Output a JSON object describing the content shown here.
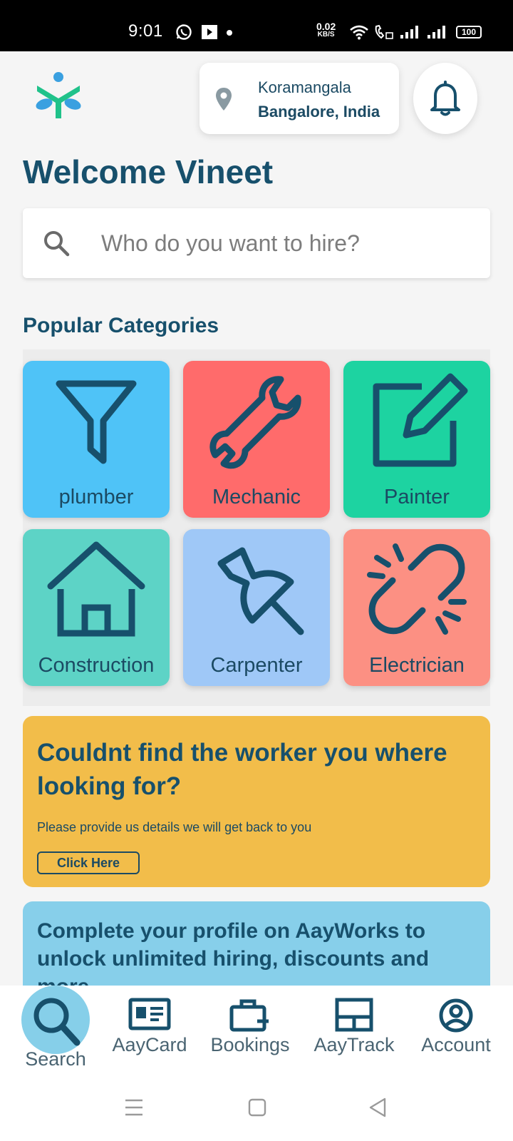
{
  "status_bar": {
    "time": "9:01",
    "net_speed": "0.02",
    "net_unit": "KB/S",
    "battery": "100"
  },
  "location": {
    "area": "Koramangala",
    "city": "Bangalore, India"
  },
  "welcome": "Welcome Vineet",
  "search": {
    "placeholder": "Who do you want to hire?"
  },
  "popular_title": "Popular Categories",
  "categories": [
    {
      "label": "plumber",
      "icon": "funnel-icon",
      "color": "#4fc3f7"
    },
    {
      "label": "Mechanic",
      "icon": "wrench-icon",
      "color": "#ff6b6b"
    },
    {
      "label": "Painter",
      "icon": "edit-icon",
      "color": "#1dd3a1"
    },
    {
      "label": "Construction",
      "icon": "house-icon",
      "color": "#5dd3c6"
    },
    {
      "label": "Carpenter",
      "icon": "pushpin-icon",
      "color": "#9fc8f7"
    },
    {
      "label": "Electrician",
      "icon": "broken-link-icon",
      "color": "#fc9083"
    }
  ],
  "banner_worker": {
    "title": "Couldnt find the worker you where looking for?",
    "subtitle": "Please provide us details we will get back to you",
    "button": "Click Here",
    "color": "#f2bd4a"
  },
  "banner_profile": {
    "title": "Complete your profile on AayWorks to unlock unlimited hiring, discounts and more",
    "color": "#87cfea"
  },
  "bottom_nav": [
    {
      "label": "Search",
      "icon": "search-icon",
      "active": true
    },
    {
      "label": "AayCard",
      "icon": "id-card-icon",
      "active": false
    },
    {
      "label": "Bookings",
      "icon": "briefcase-icon",
      "active": false
    },
    {
      "label": "AayTrack",
      "icon": "layout-icon",
      "active": false
    },
    {
      "label": "Account",
      "icon": "account-icon",
      "active": false
    }
  ],
  "colors": {
    "primary": "#17506c",
    "background": "#f5f5f5"
  }
}
